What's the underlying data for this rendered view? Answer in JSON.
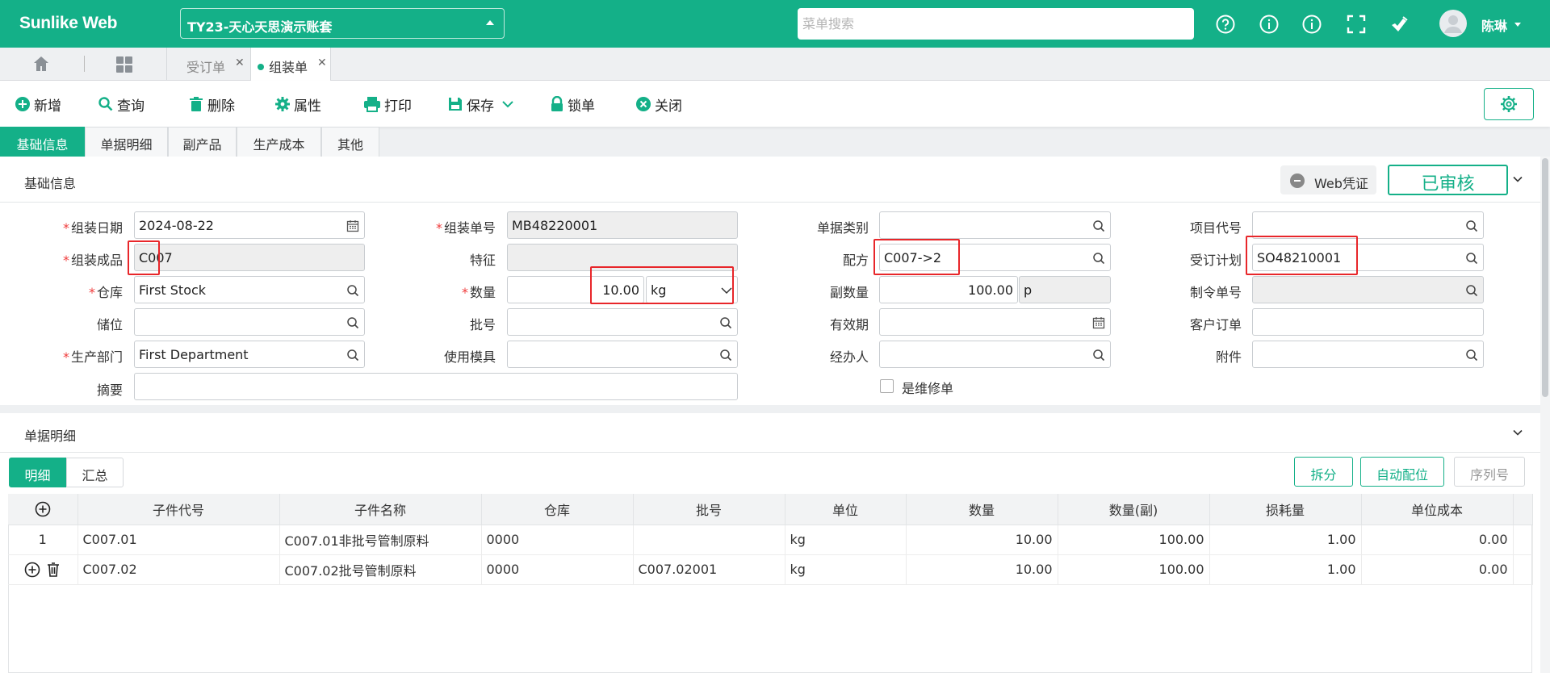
{
  "app": {
    "name": "Sunlike Web",
    "account": "TY23-天心天思演示账套",
    "search_placeholder": "菜单搜索",
    "user": "陈琳"
  },
  "tabs": {
    "order": "受订单",
    "assembly": "组装单"
  },
  "toolbar": {
    "add": "新增",
    "query": "查询",
    "delete": "删除",
    "properties": "属性",
    "print": "打印",
    "save": "保存",
    "lock": "锁单",
    "close": "关闭"
  },
  "section_tabs": [
    "基础信息",
    "单据明细",
    "副产品",
    "生产成本",
    "其他"
  ],
  "basic": {
    "title": "基础信息",
    "web_voucher": "Web凭证",
    "status": "已审核",
    "labels": {
      "date": "组装日期",
      "product": "组装成品",
      "warehouse": "仓库",
      "location": "储位",
      "dept": "生产部门",
      "summary": "摘要",
      "no": "组装单号",
      "feature": "特征",
      "qty": "数量",
      "batch": "批号",
      "mold": "使用模具",
      "doctype": "单据类别",
      "formula": "配方",
      "subqty": "副数量",
      "expiry": "有效期",
      "handler": "经办人",
      "repair": "是维修单",
      "project": "项目代号",
      "plan": "受订计划",
      "order_no": "制令单号",
      "cust_order": "客户订单",
      "attach": "附件"
    },
    "values": {
      "date": "2024-08-22",
      "product": "C007",
      "warehouse": "First Stock",
      "location": "",
      "dept": "First Department",
      "summary": "",
      "no": "MB48220001",
      "feature": "",
      "qty": "10.00",
      "unit": "kg",
      "batch": "",
      "mold": "",
      "doctype": "",
      "formula": "C007->2",
      "subqty": "100.00",
      "subunit": "p",
      "expiry": "",
      "handler": "",
      "project": "",
      "plan": "SO48210001",
      "order_no": "",
      "cust_order": "",
      "attach": ""
    }
  },
  "detail": {
    "title": "单据明细",
    "subtabs": {
      "detail": "明细",
      "summary": "汇总"
    },
    "buttons": {
      "split": "拆分",
      "auto": "自动配位",
      "serial": "序列号"
    },
    "columns": [
      "子件代号",
      "子件名称",
      "仓库",
      "批号",
      "单位",
      "数量",
      "数量(副)",
      "损耗量",
      "单位成本"
    ],
    "rows": [
      {
        "idx": "1",
        "code": "C007.01",
        "name": "C007.01非批号管制原料",
        "wh": "0000",
        "batch": "",
        "unit": "kg",
        "qty": "10.00",
        "subqty": "100.00",
        "loss": "1.00",
        "cost": "0.00"
      },
      {
        "idx": "",
        "code": "C007.02",
        "name": "C007.02批号管制原料",
        "wh": "0000",
        "batch": "C007.02001",
        "unit": "kg",
        "qty": "10.00",
        "subqty": "100.00",
        "loss": "1.00",
        "cost": "0.00"
      }
    ]
  },
  "colors": {
    "brand": "#14b088",
    "required": "#f03c3c",
    "highlight": "#e8262a"
  }
}
